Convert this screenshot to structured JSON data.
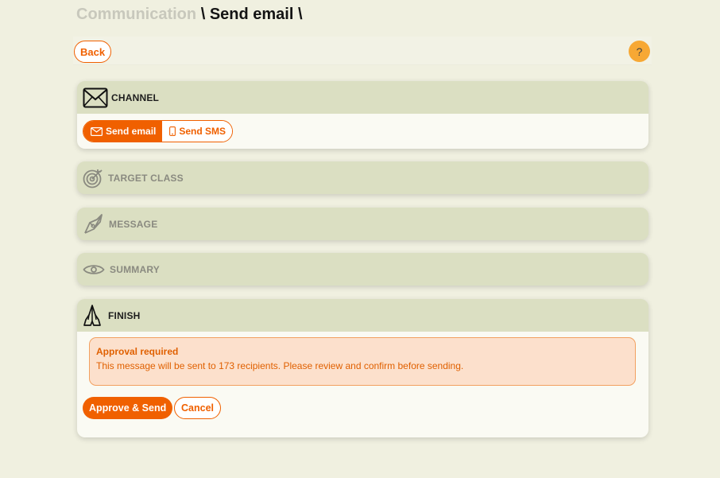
{
  "breadcrumb": {
    "parent": "Communication",
    "separator": "\\",
    "current": "Send email",
    "trailing": "\\"
  },
  "toolbar": {
    "back_label": "Back",
    "help_label": "?"
  },
  "sections": {
    "channel": {
      "title": "CHANNEL",
      "icon": "envelope-icon",
      "options": [
        {
          "label": "Send email",
          "icon": "envelope-icon",
          "selected": true
        },
        {
          "label": "Send SMS",
          "icon": "phone-icon",
          "selected": false
        }
      ]
    },
    "target_class": {
      "title": "TARGET CLASS",
      "icon": "target-icon"
    },
    "message": {
      "title": "MESSAGE",
      "icon": "pen-nib-icon"
    },
    "summary": {
      "title": "SUMMARY",
      "icon": "eye-icon"
    },
    "finish": {
      "title": "FINISH",
      "icon": "praying-hands-icon",
      "alert": {
        "title": "Approval required",
        "text": "This message will be sent to 173 recipients. Please review and confirm before sending."
      },
      "approve_label": "Approve & Send",
      "cancel_label": "Cancel"
    }
  },
  "colors": {
    "accent": "#f06000",
    "panel_header": "#dbdfc2",
    "page_background": "#f0f0e0",
    "help_button": "#f7a834",
    "alert_background": "#fce0cc"
  }
}
